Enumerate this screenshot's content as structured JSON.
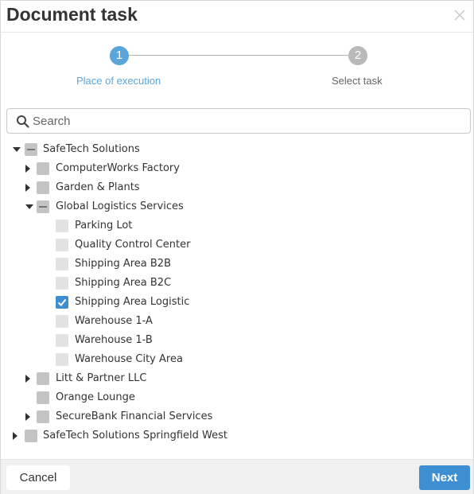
{
  "dialog": {
    "title": "Document task"
  },
  "stepper": {
    "steps": [
      {
        "number": "1",
        "label": "Place of execution",
        "state": "active"
      },
      {
        "number": "2",
        "label": "Select task",
        "state": "inactive"
      }
    ]
  },
  "search": {
    "placeholder": "Search",
    "value": ""
  },
  "tree": {
    "items": [
      {
        "label": "SafeTech Solutions",
        "expanded": true,
        "state": "partial"
      },
      {
        "label": "ComputerWorks Factory",
        "expanded": false,
        "state": "unchecked"
      },
      {
        "label": "Garden & Plants",
        "expanded": false,
        "state": "unchecked"
      },
      {
        "label": "Global Logistics Services",
        "expanded": true,
        "state": "partial"
      },
      {
        "label": "Parking Lot",
        "state": "unchecked"
      },
      {
        "label": "Quality Control Center",
        "state": "unchecked"
      },
      {
        "label": "Shipping Area B2B",
        "state": "unchecked"
      },
      {
        "label": "Shipping Area B2C",
        "state": "unchecked"
      },
      {
        "label": "Shipping Area Logistic",
        "state": "checked"
      },
      {
        "label": "Warehouse 1-A",
        "state": "unchecked"
      },
      {
        "label": "Warehouse 1-B",
        "state": "unchecked"
      },
      {
        "label": "Warehouse City Area",
        "state": "unchecked"
      },
      {
        "label": "Litt & Partner LLC",
        "expanded": false,
        "state": "unchecked"
      },
      {
        "label": "Orange Lounge",
        "state": "unchecked"
      },
      {
        "label": "SecureBank Financial Services",
        "expanded": false,
        "state": "unchecked"
      },
      {
        "label": "SafeTech Solutions Springfield West",
        "expanded": false,
        "state": "unchecked"
      }
    ]
  },
  "footer": {
    "cancel_label": "Cancel",
    "next_label": "Next"
  },
  "colors": {
    "accent": "#3d8fd1",
    "step_active": "#5aa5d9",
    "step_inactive": "#b9b9b9"
  }
}
